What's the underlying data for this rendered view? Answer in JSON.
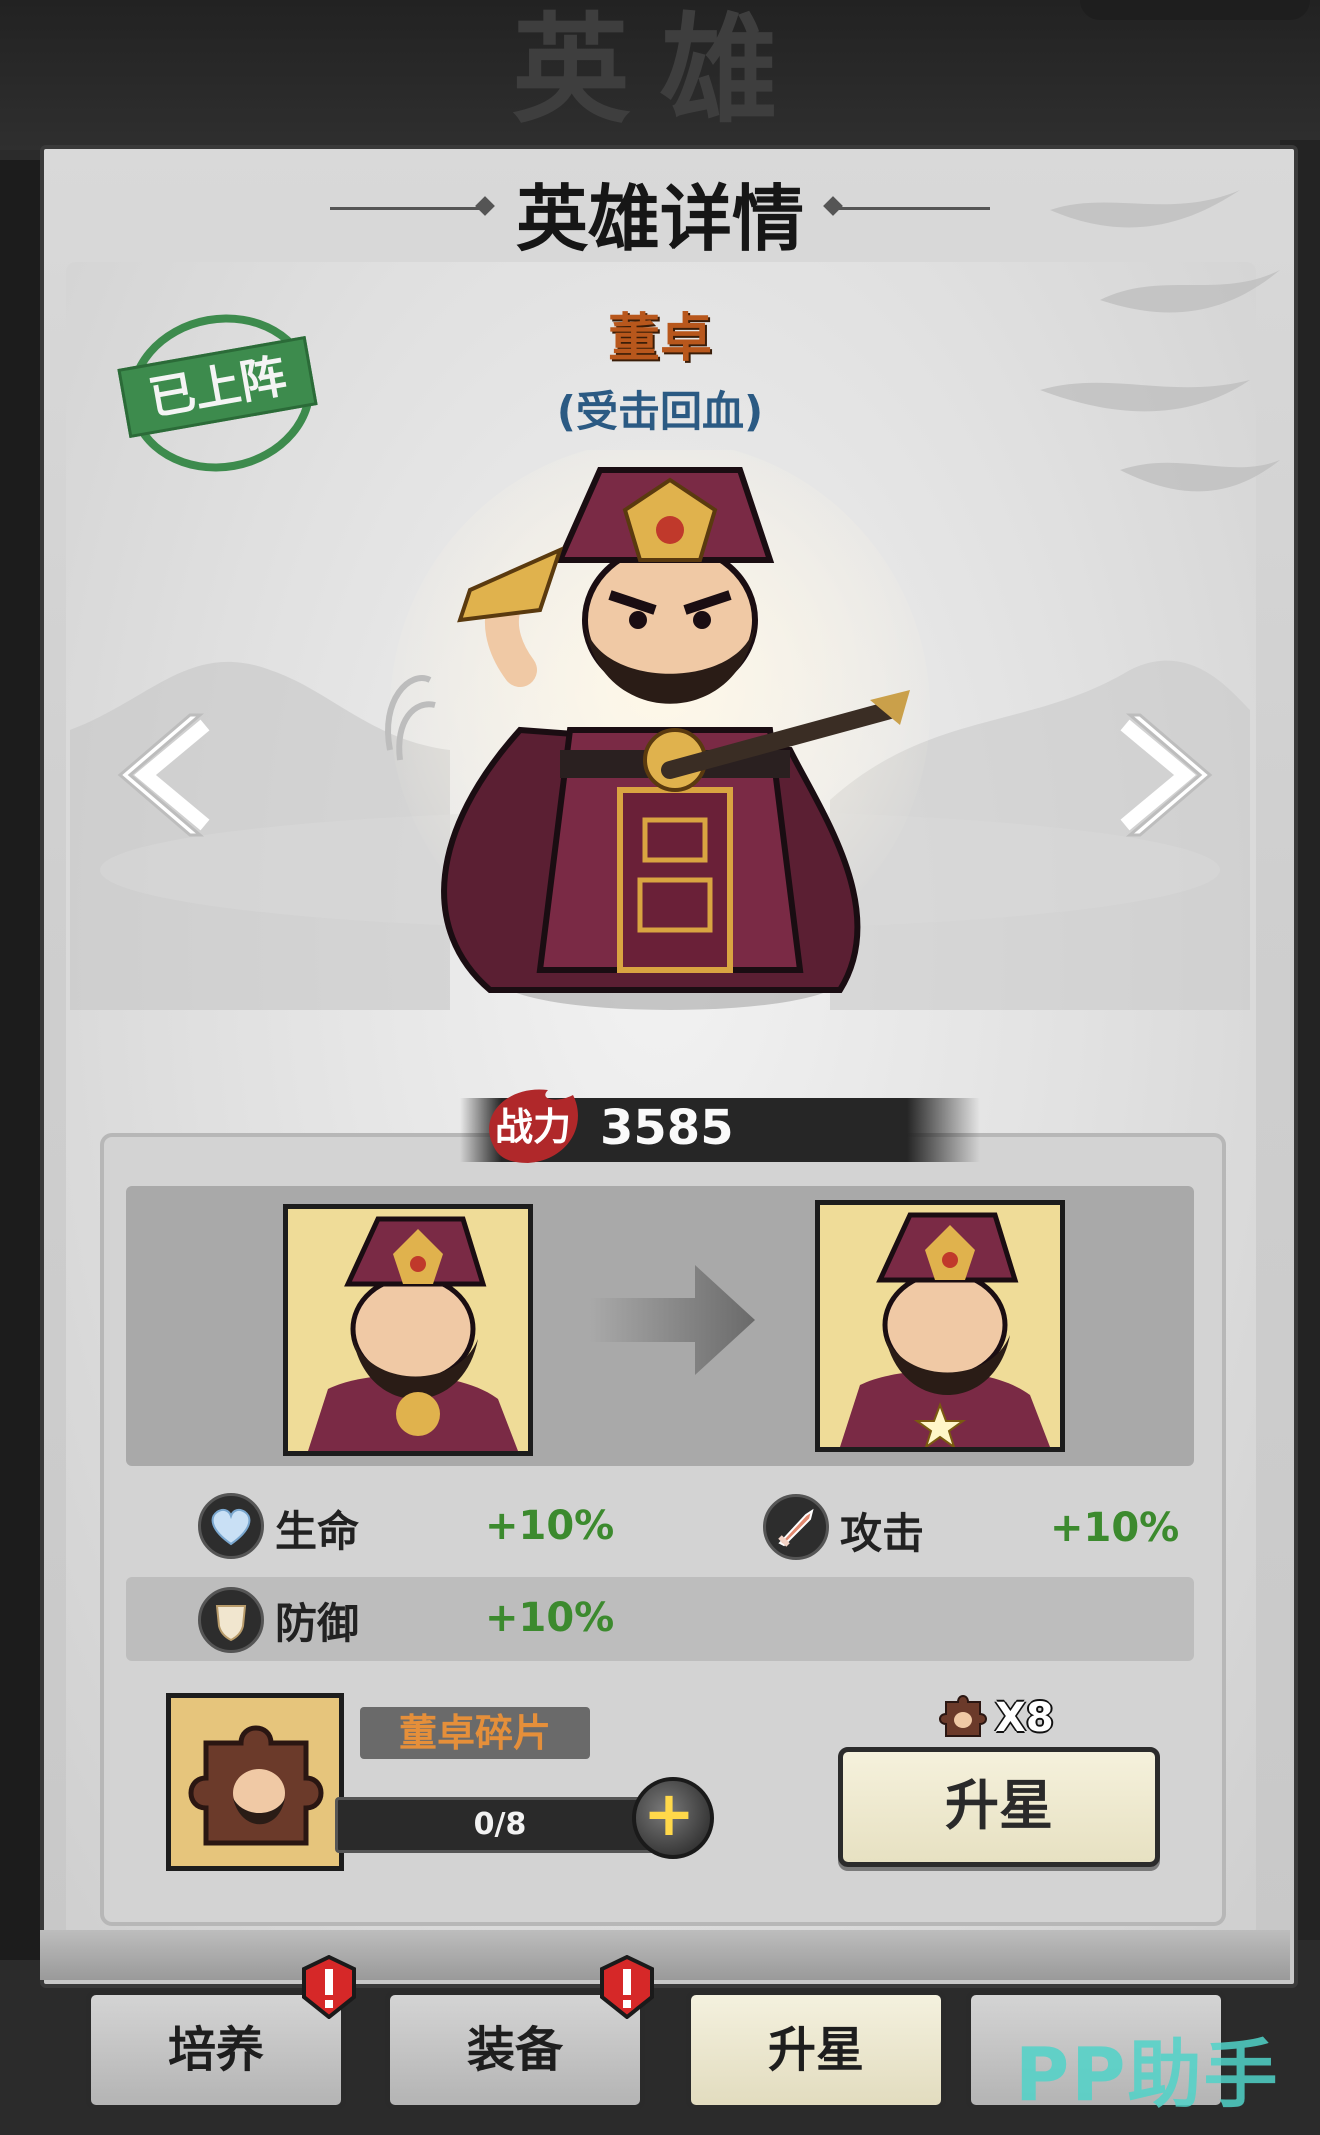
{
  "header": {
    "title": "英雄"
  },
  "page": {
    "heading": "英雄详情"
  },
  "hero": {
    "name": "董卓",
    "trait": "(受击回血)",
    "status_stamp": "已上阵",
    "power_label": "战力",
    "power": "3585"
  },
  "stats": [
    {
      "icon": "heart-icon",
      "label": "生命",
      "value": "+10%"
    },
    {
      "icon": "sword-icon",
      "label": "攻击",
      "value": "+10%"
    },
    {
      "icon": "shield-icon",
      "label": "防御",
      "value": "+10%"
    }
  ],
  "fragment": {
    "name": "董卓碎片",
    "count_text": "0/8",
    "progress": 0,
    "cost_text": "X8"
  },
  "actions": {
    "star_up_label": "升星"
  },
  "tabs": [
    {
      "label": "培养",
      "alert": true,
      "active": false
    },
    {
      "label": "装备",
      "alert": true,
      "active": false
    },
    {
      "label": "升星",
      "alert": false,
      "active": true
    },
    {
      "label": "",
      "alert": false,
      "active": false
    }
  ],
  "watermark": "PP助手",
  "colors": {
    "hero_name": "#b8571c",
    "trait": "#2b5a83",
    "stat_value": "#3c8a2e",
    "stamp": "#3d8b4d",
    "alert": "#d62828"
  }
}
